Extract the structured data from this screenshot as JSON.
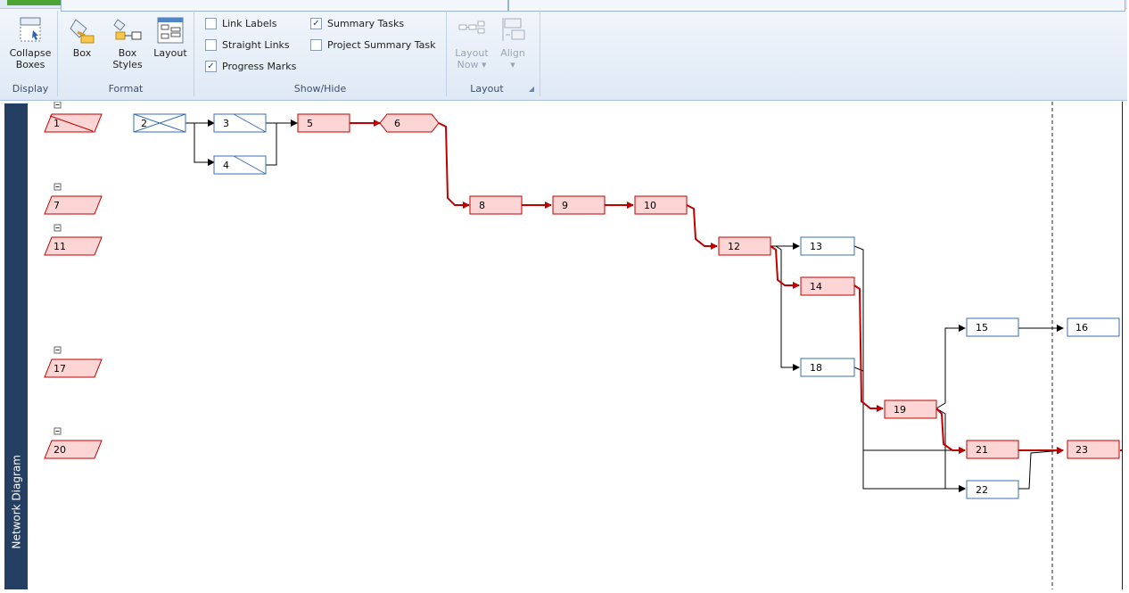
{
  "ribbon": {
    "display": {
      "label": "Display",
      "collapse_label_1": "Collapse",
      "collapse_label_2": "Boxes"
    },
    "format": {
      "label": "Format",
      "box_label": "Box",
      "box_styles_label_1": "Box",
      "box_styles_label_2": "Styles",
      "layout_label": "Layout"
    },
    "showhide": {
      "label": "Show/Hide",
      "link_labels": "Link Labels",
      "link_labels_checked": false,
      "straight_links": "Straight Links",
      "straight_links_checked": false,
      "progress_marks": "Progress Marks",
      "progress_marks_checked": true,
      "summary_tasks": "Summary Tasks",
      "summary_tasks_checked": true,
      "project_summary_task": "Project Summary Task",
      "project_summary_task_checked": false
    },
    "layout": {
      "label": "Layout",
      "layout_now_1": "Layout",
      "layout_now_2": "Now",
      "align": "Align"
    }
  },
  "sidebar": {
    "label": "Network Diagram"
  },
  "diagram": {
    "colors": {
      "critical_fill": "#fdd5d5",
      "critical_stroke": "#c00000",
      "normal_stroke": "#3a6fb5",
      "link_black": "#000000",
      "link_red": "#c00000"
    },
    "summary_tasks": [
      "1",
      "7",
      "11",
      "17",
      "20"
    ],
    "tasks": [
      {
        "id": "2",
        "state": "complete"
      },
      {
        "id": "3",
        "state": "in-progress"
      },
      {
        "id": "4",
        "state": "in-progress"
      },
      {
        "id": "5",
        "state": "critical"
      },
      {
        "id": "6",
        "state": "milestone-critical"
      },
      {
        "id": "8",
        "state": "critical"
      },
      {
        "id": "9",
        "state": "critical"
      },
      {
        "id": "10",
        "state": "critical"
      },
      {
        "id": "12",
        "state": "critical"
      },
      {
        "id": "13",
        "state": "normal"
      },
      {
        "id": "14",
        "state": "critical"
      },
      {
        "id": "15",
        "state": "normal"
      },
      {
        "id": "16",
        "state": "normal"
      },
      {
        "id": "18",
        "state": "normal"
      },
      {
        "id": "19",
        "state": "critical"
      },
      {
        "id": "21",
        "state": "critical"
      },
      {
        "id": "22",
        "state": "normal"
      },
      {
        "id": "23",
        "state": "critical"
      }
    ]
  }
}
